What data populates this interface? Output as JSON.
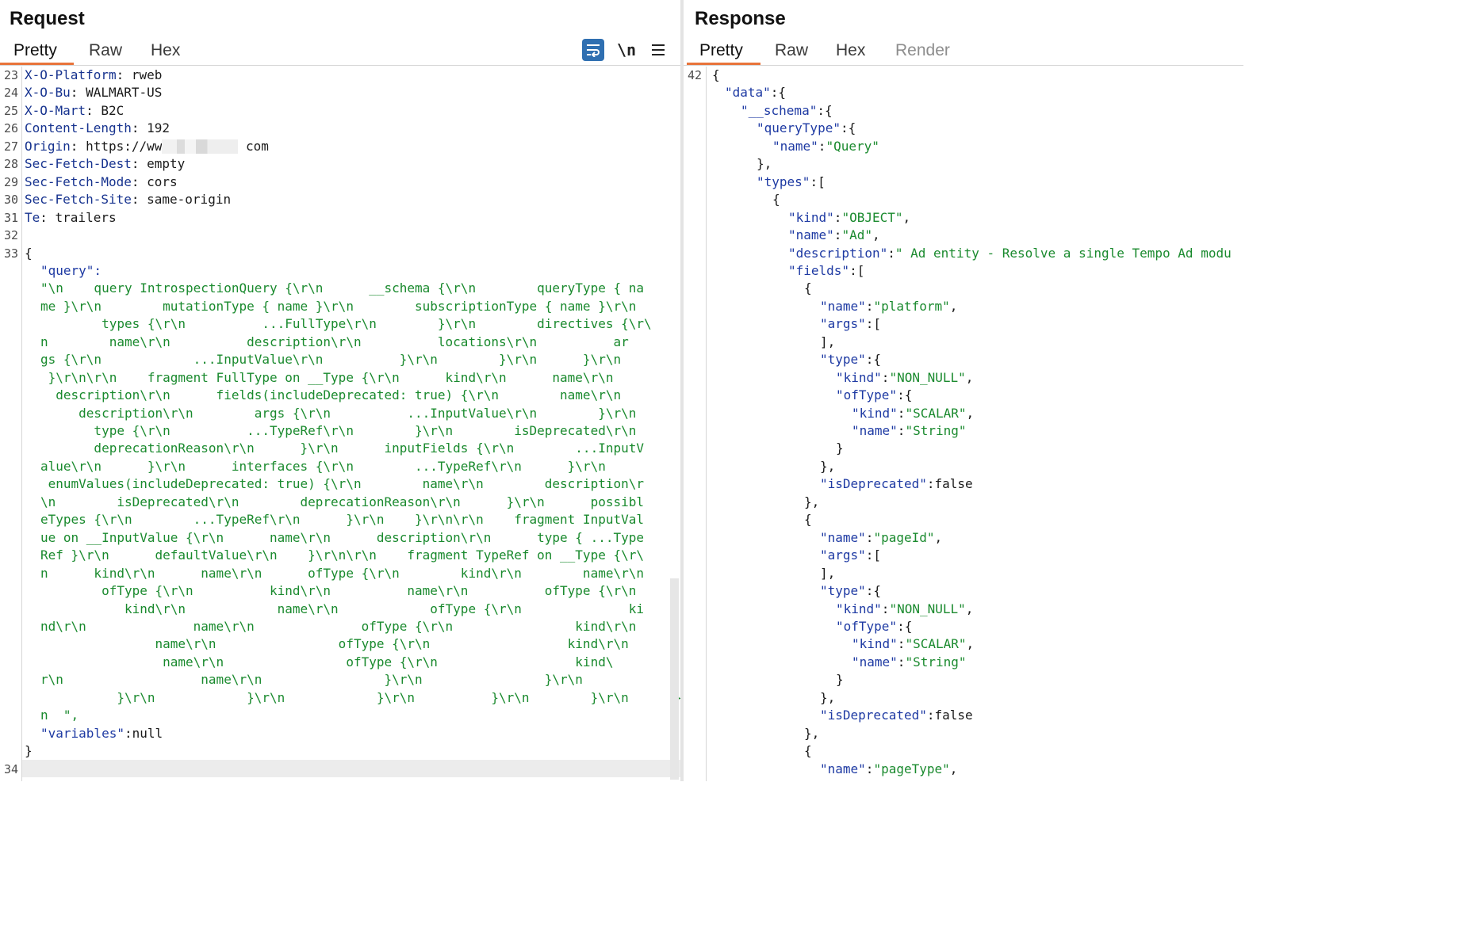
{
  "request": {
    "title": "Request",
    "tabs": [
      "Pretty",
      "Raw",
      "Hex"
    ],
    "tools": {
      "wrap": "≡",
      "newline": "\\n",
      "menu": "☰"
    },
    "header_lines": [
      {
        "n": "23",
        "k": "X-O-Platform",
        "v": "rweb"
      },
      {
        "n": "24",
        "k": "X-O-Bu",
        "v": "WALMART-US"
      },
      {
        "n": "25",
        "k": "X-O-Mart",
        "v": "B2C"
      },
      {
        "n": "26",
        "k": "Content-Length",
        "v": "192"
      },
      {
        "n": "27",
        "k": "Origin",
        "v": "https://ww",
        "v2": "com"
      },
      {
        "n": "28",
        "k": "Sec-Fetch-Dest",
        "v": "empty"
      },
      {
        "n": "29",
        "k": "Sec-Fetch-Mode",
        "v": "cors"
      },
      {
        "n": "30",
        "k": "Sec-Fetch-Site",
        "v": "same-origin"
      },
      {
        "n": "31",
        "k": "Te",
        "v": "trailers"
      }
    ],
    "blank_line": "32",
    "body_start_line": "33",
    "body_open": "{",
    "query_key": "\"query\"",
    "query_lines": [
      "\"\\n    query IntrospectionQuery {\\r\\n      __schema {\\r\\n        queryType { na",
      "me }\\r\\n        mutationType { name }\\r\\n        subscriptionType { name }\\r\\n",
      "        types {\\r\\n          ...FullType\\r\\n        }\\r\\n        directives {\\r\\",
      "n        name\\r\\n          description\\r\\n          locations\\r\\n          ar",
      "gs {\\r\\n            ...InputValue\\r\\n          }\\r\\n        }\\r\\n      }\\r\\n",
      " }\\r\\n\\r\\n    fragment FullType on __Type {\\r\\n      kind\\r\\n      name\\r\\n",
      "  description\\r\\n      fields(includeDeprecated: true) {\\r\\n        name\\r\\n",
      "     description\\r\\n        args {\\r\\n          ...InputValue\\r\\n        }\\r\\n",
      "       type {\\r\\n          ...TypeRef\\r\\n        }\\r\\n        isDeprecated\\r\\n",
      "       deprecationReason\\r\\n      }\\r\\n      inputFields {\\r\\n        ...InputV",
      "alue\\r\\n      }\\r\\n      interfaces {\\r\\n        ...TypeRef\\r\\n      }\\r\\n",
      " enumValues(includeDeprecated: true) {\\r\\n        name\\r\\n        description\\r",
      "\\n        isDeprecated\\r\\n        deprecationReason\\r\\n      }\\r\\n      possibl",
      "eTypes {\\r\\n        ...TypeRef\\r\\n      }\\r\\n    }\\r\\n\\r\\n    fragment InputVal",
      "ue on __InputValue {\\r\\n      name\\r\\n      description\\r\\n      type { ...Type",
      "Ref }\\r\\n      defaultValue\\r\\n    }\\r\\n\\r\\n    fragment TypeRef on __Type {\\r\\",
      "n      kind\\r\\n      name\\r\\n      ofType {\\r\\n        kind\\r\\n        name\\r\\n",
      "        ofType {\\r\\n          kind\\r\\n          name\\r\\n          ofType {\\r\\n",
      "           kind\\r\\n            name\\r\\n            ofType {\\r\\n              ki",
      "nd\\r\\n              name\\r\\n              ofType {\\r\\n                kind\\r\\n",
      "               name\\r\\n                ofType {\\r\\n                  kind\\r\\n",
      "                name\\r\\n                ofType {\\r\\n                  kind\\",
      "r\\n                  name\\r\\n                }\\r\\n                }\\r\\n",
      "          }\\r\\n            }\\r\\n            }\\r\\n          }\\r\\n        }\\r\\n      }\\r\\",
      "n  \","
    ],
    "variables_line": "\"variables\":null",
    "body_close": "}",
    "last_line": "34"
  },
  "response": {
    "title": "Response",
    "tabs": [
      "Pretty",
      "Raw",
      "Hex",
      "Render"
    ],
    "start_line": "42",
    "lines": [
      {
        "i": 0,
        "t": [
          [
            "pun",
            "{"
          ]
        ]
      },
      {
        "i": 1,
        "t": [
          [
            "key",
            "\"data\""
          ],
          [
            "pun",
            ":{"
          ]
        ]
      },
      {
        "i": 2,
        "t": [
          [
            "key",
            "\"__schema\""
          ],
          [
            "pun",
            ":{"
          ]
        ]
      },
      {
        "i": 3,
        "t": [
          [
            "key",
            "\"queryType\""
          ],
          [
            "pun",
            ":{"
          ]
        ]
      },
      {
        "i": 4,
        "t": [
          [
            "key",
            "\"name\""
          ],
          [
            "pun",
            ":"
          ],
          [
            "str",
            "\"Query\""
          ]
        ]
      },
      {
        "i": 3,
        "t": [
          [
            "pun",
            "},"
          ]
        ]
      },
      {
        "i": 3,
        "t": [
          [
            "key",
            "\"types\""
          ],
          [
            "pun",
            ":["
          ]
        ]
      },
      {
        "i": 4,
        "t": [
          [
            "pun",
            "{"
          ]
        ]
      },
      {
        "i": 5,
        "t": [
          [
            "key",
            "\"kind\""
          ],
          [
            "pun",
            ":"
          ],
          [
            "str",
            "\"OBJECT\""
          ],
          [
            "pun",
            ","
          ]
        ]
      },
      {
        "i": 5,
        "t": [
          [
            "key",
            "\"name\""
          ],
          [
            "pun",
            ":"
          ],
          [
            "str",
            "\"Ad\""
          ],
          [
            "pun",
            ","
          ]
        ]
      },
      {
        "i": 5,
        "t": [
          [
            "key",
            "\"description\""
          ],
          [
            "pun",
            ":"
          ],
          [
            "str",
            "\" Ad entity - Resolve a single Tempo Ad modu"
          ]
        ]
      },
      {
        "i": 5,
        "t": [
          [
            "key",
            "\"fields\""
          ],
          [
            "pun",
            ":["
          ]
        ]
      },
      {
        "i": 6,
        "t": [
          [
            "pun",
            "{"
          ]
        ]
      },
      {
        "i": 7,
        "t": [
          [
            "key",
            "\"name\""
          ],
          [
            "pun",
            ":"
          ],
          [
            "str",
            "\"platform\""
          ],
          [
            "pun",
            ","
          ]
        ]
      },
      {
        "i": 7,
        "t": [
          [
            "key",
            "\"args\""
          ],
          [
            "pun",
            ":["
          ]
        ]
      },
      {
        "i": 7,
        "t": [
          [
            "pun",
            "],"
          ]
        ]
      },
      {
        "i": 7,
        "t": [
          [
            "key",
            "\"type\""
          ],
          [
            "pun",
            ":{"
          ]
        ]
      },
      {
        "i": 8,
        "t": [
          [
            "key",
            "\"kind\""
          ],
          [
            "pun",
            ":"
          ],
          [
            "str",
            "\"NON_NULL\""
          ],
          [
            "pun",
            ","
          ]
        ]
      },
      {
        "i": 8,
        "t": [
          [
            "key",
            "\"ofType\""
          ],
          [
            "pun",
            ":{"
          ]
        ]
      },
      {
        "i": 9,
        "t": [
          [
            "key",
            "\"kind\""
          ],
          [
            "pun",
            ":"
          ],
          [
            "str",
            "\"SCALAR\""
          ],
          [
            "pun",
            ","
          ]
        ]
      },
      {
        "i": 9,
        "t": [
          [
            "key",
            "\"name\""
          ],
          [
            "pun",
            ":"
          ],
          [
            "str",
            "\"String\""
          ]
        ]
      },
      {
        "i": 8,
        "t": [
          [
            "pun",
            "}"
          ]
        ]
      },
      {
        "i": 7,
        "t": [
          [
            "pun",
            "},"
          ]
        ]
      },
      {
        "i": 7,
        "t": [
          [
            "key",
            "\"isDeprecated\""
          ],
          [
            "pun",
            ":false"
          ]
        ]
      },
      {
        "i": 6,
        "t": [
          [
            "pun",
            "},"
          ]
        ]
      },
      {
        "i": 6,
        "t": [
          [
            "pun",
            "{"
          ]
        ]
      },
      {
        "i": 7,
        "t": [
          [
            "key",
            "\"name\""
          ],
          [
            "pun",
            ":"
          ],
          [
            "str",
            "\"pageId\""
          ],
          [
            "pun",
            ","
          ]
        ]
      },
      {
        "i": 7,
        "t": [
          [
            "key",
            "\"args\""
          ],
          [
            "pun",
            ":["
          ]
        ]
      },
      {
        "i": 7,
        "t": [
          [
            "pun",
            "],"
          ]
        ]
      },
      {
        "i": 7,
        "t": [
          [
            "key",
            "\"type\""
          ],
          [
            "pun",
            ":{"
          ]
        ]
      },
      {
        "i": 8,
        "t": [
          [
            "key",
            "\"kind\""
          ],
          [
            "pun",
            ":"
          ],
          [
            "str",
            "\"NON_NULL\""
          ],
          [
            "pun",
            ","
          ]
        ]
      },
      {
        "i": 8,
        "t": [
          [
            "key",
            "\"ofType\""
          ],
          [
            "pun",
            ":{"
          ]
        ]
      },
      {
        "i": 9,
        "t": [
          [
            "key",
            "\"kind\""
          ],
          [
            "pun",
            ":"
          ],
          [
            "str",
            "\"SCALAR\""
          ],
          [
            "pun",
            ","
          ]
        ]
      },
      {
        "i": 9,
        "t": [
          [
            "key",
            "\"name\""
          ],
          [
            "pun",
            ":"
          ],
          [
            "str",
            "\"String\""
          ]
        ]
      },
      {
        "i": 8,
        "t": [
          [
            "pun",
            "}"
          ]
        ]
      },
      {
        "i": 7,
        "t": [
          [
            "pun",
            "},"
          ]
        ]
      },
      {
        "i": 7,
        "t": [
          [
            "key",
            "\"isDeprecated\""
          ],
          [
            "pun",
            ":false"
          ]
        ]
      },
      {
        "i": 6,
        "t": [
          [
            "pun",
            "},"
          ]
        ]
      },
      {
        "i": 6,
        "t": [
          [
            "pun",
            "{"
          ]
        ]
      },
      {
        "i": 7,
        "t": [
          [
            "key",
            "\"name\""
          ],
          [
            "pun",
            ":"
          ],
          [
            "str",
            "\"pageType\""
          ],
          [
            "pun",
            ","
          ]
        ]
      }
    ]
  },
  "colors": {
    "accent_tab": "#e8743b",
    "wrap_button": "#2f6fb1",
    "string": "#1a8a2e",
    "key": "#1e3aa3"
  }
}
